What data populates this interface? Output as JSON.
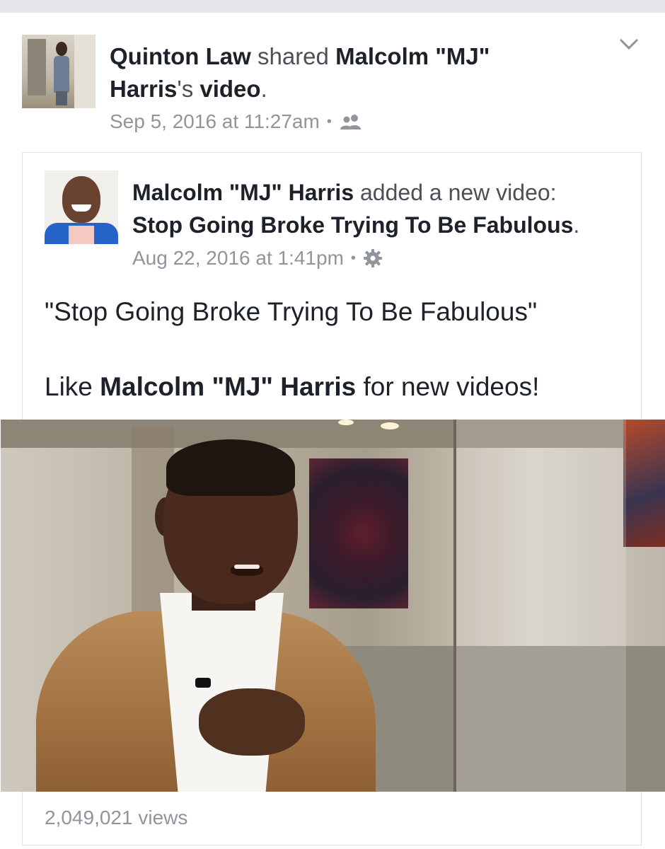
{
  "sharer": {
    "name": "Quinton Law",
    "action_text": "shared",
    "original_name": "Malcolm \"MJ\"",
    "original_name_2": "Harris",
    "possessive": "'s",
    "video_word": "video",
    "period": ".",
    "timestamp": "Sep 5, 2016 at 11:27am",
    "separator": "•",
    "audience_icon": "friends-icon"
  },
  "original_post": {
    "author": "Malcolm \"MJ\" Harris",
    "action_text": "added a new video:",
    "video_title": "Stop Going Broke Trying To Be Fabulous",
    "period": ".",
    "timestamp": "Aug 22, 2016 at 1:41pm",
    "separator": "•",
    "audience_icon": "gear-icon",
    "body_line1": "\"Stop Going Broke Trying To Be Fabulous\"",
    "body_like": "Like",
    "body_author": "Malcolm \"MJ\" Harris",
    "body_rest": "for new videos!",
    "views": "2,049,021 views"
  },
  "colors": {
    "text": "#1d2129",
    "meta": "#90949c",
    "border": "#dddfe2",
    "top_strip": "#e4e6eb"
  }
}
